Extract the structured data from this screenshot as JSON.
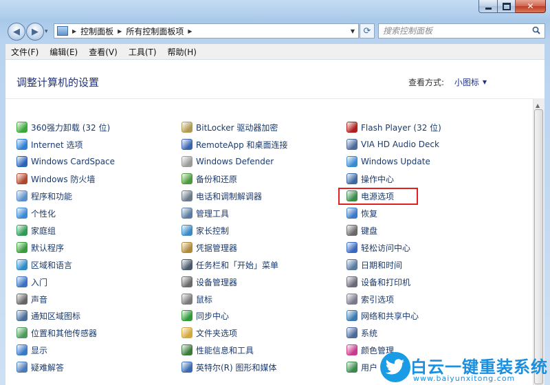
{
  "window": {
    "title_buttons": {
      "minimize": "minimize-icon",
      "maximize": "maximize-icon",
      "close": "close-icon"
    }
  },
  "nav": {
    "back_icon": "back-arrow-icon",
    "forward_icon": "forward-arrow-icon",
    "breadcrumbs": [
      "控制面板",
      "所有控制面板项"
    ],
    "search_placeholder": "搜索控制面板"
  },
  "menu": [
    "文件(F)",
    "编辑(E)",
    "查看(V)",
    "工具(T)",
    "帮助(H)"
  ],
  "content": {
    "heading": "调整计算机的设置",
    "view_by_label": "查看方式:",
    "view_by_value": "小图标"
  },
  "columns": [
    [
      {
        "label": "360强力卸载 (32 位)",
        "icon": "uninstall-icon",
        "color": "#3aa83a"
      },
      {
        "label": "Internet 选项",
        "icon": "internet-options-icon",
        "color": "#2f7fd4"
      },
      {
        "label": "Windows CardSpace",
        "icon": "cardspace-icon",
        "color": "#2a63b8"
      },
      {
        "label": "Windows 防火墙",
        "icon": "firewall-icon",
        "color": "#b0462c"
      },
      {
        "label": "程序和功能",
        "icon": "programs-icon",
        "color": "#5c8fc9"
      },
      {
        "label": "个性化",
        "icon": "personalization-icon",
        "color": "#3c8ad6"
      },
      {
        "label": "家庭组",
        "icon": "homegroup-icon",
        "color": "#2e9b52"
      },
      {
        "label": "默认程序",
        "icon": "default-programs-icon",
        "color": "#3a9c3a"
      },
      {
        "label": "区域和语言",
        "icon": "region-icon",
        "color": "#2f8ac8"
      },
      {
        "label": "入门",
        "icon": "getting-started-icon",
        "color": "#3b72c4"
      },
      {
        "label": "声音",
        "icon": "sound-icon",
        "color": "#666666"
      },
      {
        "label": "通知区域图标",
        "icon": "notification-icon",
        "color": "#4a6d9a"
      },
      {
        "label": "位置和其他传感器",
        "icon": "sensor-icon",
        "color": "#4a9a5a"
      },
      {
        "label": "显示",
        "icon": "display-icon",
        "color": "#3a78c8"
      },
      {
        "label": "疑难解答",
        "icon": "troubleshoot-icon",
        "color": "#4a7ab8"
      }
    ],
    [
      {
        "label": "BitLocker 驱动器加密",
        "icon": "bitlocker-icon",
        "color": "#b09a50"
      },
      {
        "label": "RemoteApp 和桌面连接",
        "icon": "remoteapp-icon",
        "color": "#3a64b0"
      },
      {
        "label": "Windows Defender",
        "icon": "defender-icon",
        "color": "#9a9a9a"
      },
      {
        "label": "备份和还原",
        "icon": "backup-icon",
        "color": "#4a9a3a"
      },
      {
        "label": "电话和调制解调器",
        "icon": "phone-modem-icon",
        "color": "#6a7a8a"
      },
      {
        "label": "管理工具",
        "icon": "admin-tools-icon",
        "color": "#5a7ca0"
      },
      {
        "label": "家长控制",
        "icon": "parental-control-icon",
        "color": "#3a8ac8"
      },
      {
        "label": "凭据管理器",
        "icon": "credential-icon",
        "color": "#b08a3a"
      },
      {
        "label": "任务栏和「开始」菜单",
        "icon": "taskbar-icon",
        "color": "#4a5a6a"
      },
      {
        "label": "设备管理器",
        "icon": "device-manager-icon",
        "color": "#6a6a6a"
      },
      {
        "label": "鼠标",
        "icon": "mouse-icon",
        "color": "#7a7a7a"
      },
      {
        "label": "同步中心",
        "icon": "sync-icon",
        "color": "#2e9a3a"
      },
      {
        "label": "文件夹选项",
        "icon": "folder-options-icon",
        "color": "#d4a83a"
      },
      {
        "label": "性能信息和工具",
        "icon": "performance-icon",
        "color": "#3a7a3a"
      },
      {
        "label": "英特尔(R) 图形和媒体",
        "icon": "intel-graphics-icon",
        "color": "#3a6ab0"
      }
    ],
    [
      {
        "label": "Flash Player (32 位)",
        "icon": "flash-icon",
        "color": "#b01e1e"
      },
      {
        "label": "VIA HD Audio Deck",
        "icon": "audio-deck-icon",
        "color": "#4a6a9a"
      },
      {
        "label": "Windows Update",
        "icon": "windows-update-icon",
        "color": "#3a8ad0"
      },
      {
        "label": "操作中心",
        "icon": "action-center-icon",
        "color": "#3a6aa0"
      },
      {
        "label": "电源选项",
        "icon": "power-options-icon",
        "color": "#3a8a4a"
      },
      {
        "label": "恢复",
        "icon": "recovery-icon",
        "color": "#3a7ac8"
      },
      {
        "label": "键盘",
        "icon": "keyboard-icon",
        "color": "#6a6a6a"
      },
      {
        "label": "轻松访问中心",
        "icon": "ease-of-access-icon",
        "color": "#3a6ac0"
      },
      {
        "label": "日期和时间",
        "icon": "date-time-icon",
        "color": "#5a7aa0"
      },
      {
        "label": "设备和打印机",
        "icon": "printer-icon",
        "color": "#6a6a7a"
      },
      {
        "label": "索引选项",
        "icon": "indexing-icon",
        "color": "#7a7a8a"
      },
      {
        "label": "网络和共享中心",
        "icon": "network-icon",
        "color": "#3a7ab0"
      },
      {
        "label": "系统",
        "icon": "system-icon",
        "color": "#4a6a9a"
      },
      {
        "label": "颜色管理",
        "icon": "color-management-icon",
        "color": "#c83a8a"
      },
      {
        "label": "用户",
        "icon": "user-accounts-icon",
        "color": "#3a8a4a"
      }
    ]
  ],
  "watermark": {
    "text": "白云一键重装系统",
    "url": "www.baiyunxitong.com"
  }
}
